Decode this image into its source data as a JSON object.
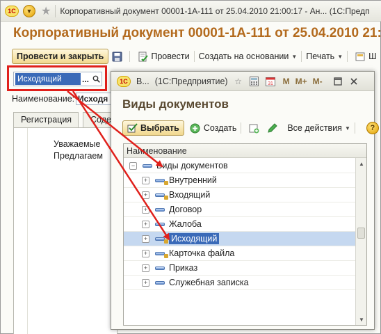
{
  "titlebar": {
    "logo": "1С",
    "title": "Корпоративный документ 00001-1А-111 от 25.04.2010 21:00:17 - Ан... (1С:Предп"
  },
  "document": {
    "title": "Корпоративный документ 00001-1А-111 от 25.04.2010 21:0",
    "toolbar": {
      "post_close": "Провести и закрыть",
      "post": "Провести",
      "create_based": "Создать на основании",
      "print": "Печать",
      "more": "Ш"
    },
    "kind_field": {
      "value": "Исходящий",
      "dots": "..."
    },
    "name_label": "Наименование:",
    "name_value": "Исходя",
    "tabs": [
      "Регистрация",
      "Содер"
    ],
    "body_lines": [
      "Уважаемые",
      "Предлагаем"
    ]
  },
  "dialog": {
    "window_title": "В...",
    "app_title": "(1С:Предприятие)",
    "buttons_title": [
      "M",
      "M+",
      "M-"
    ],
    "heading": "Виды документов",
    "toolbar": {
      "select": "Выбрать",
      "create": "Создать",
      "all_actions": "Все действия",
      "help": "?"
    },
    "column_header": "Наименование",
    "root": "Виды документов",
    "items": [
      {
        "label": "Внутренний"
      },
      {
        "label": "Входящий"
      },
      {
        "label": "Договор"
      },
      {
        "label": "Жалоба"
      },
      {
        "label": "Исходящий"
      },
      {
        "label": "Карточка файла"
      },
      {
        "label": "Приказ"
      },
      {
        "label": "Служебная записка"
      }
    ],
    "selected_index": 4
  },
  "colors": {
    "accent_title": "#b36a1d",
    "highlight_red": "#e0201b",
    "selection_blue": "#3a6ab8",
    "row_selected": "#c5d8f0"
  }
}
